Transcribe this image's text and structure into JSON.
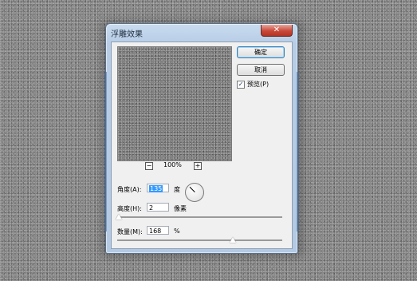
{
  "dialog": {
    "title": "浮雕效果",
    "close_glyph": "✕",
    "buttons": {
      "ok": "确定",
      "cancel": "取消"
    },
    "preview_checkbox": {
      "label": "预览(P)",
      "checked": true,
      "check_glyph": "✓"
    },
    "zoom": {
      "minus_glyph": "−",
      "plus_glyph": "+",
      "value": "100%"
    },
    "angle": {
      "label": "角度(A):",
      "value": "135",
      "unit": "度",
      "dial_degrees": 135
    },
    "height": {
      "label": "高度(H):",
      "value": "2",
      "unit": "像素",
      "slider_fraction": 0.01
    },
    "amount": {
      "label": "数量(M):",
      "value": "168",
      "unit": "%",
      "slider_fraction": 0.7
    }
  }
}
